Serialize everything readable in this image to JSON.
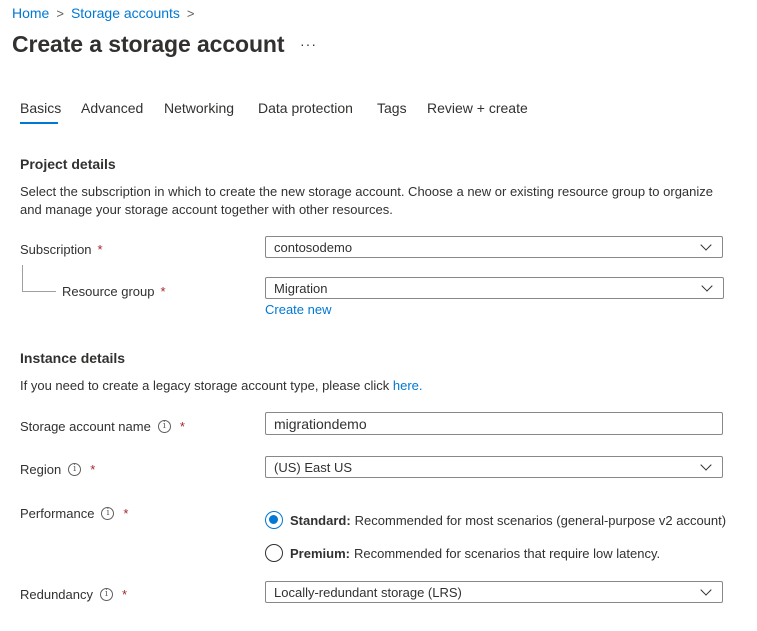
{
  "breadcrumb": {
    "home": "Home",
    "storage_accounts": "Storage accounts",
    "sep1": ">",
    "sep2": ">"
  },
  "page": {
    "title": "Create a storage account",
    "more": "···"
  },
  "tabs": [
    {
      "label": "Basics",
      "active": true
    },
    {
      "label": "Advanced"
    },
    {
      "label": "Networking"
    },
    {
      "label": "Data protection"
    },
    {
      "label": "Tags"
    },
    {
      "label": "Review + create"
    }
  ],
  "project": {
    "title": "Project details",
    "description": "Select the subscription in which to create the new storage account. Choose a new or existing resource group to organize and manage your storage account together with other resources.",
    "subscription_label": "Subscription",
    "subscription_value": "contosodemo",
    "resource_group_label": "Resource group",
    "resource_group_value": "Migration",
    "create_new": "Create new"
  },
  "instance": {
    "title": "Instance details",
    "description_prefix": "If you need to create a legacy storage account type, please click ",
    "description_link": "here.",
    "name_label": "Storage account name",
    "name_value": "migrationdemo",
    "region_label": "Region",
    "region_value": "(US) East US",
    "performance_label": "Performance",
    "performance_options": [
      {
        "name": "Standard:",
        "desc": "Recommended for most scenarios (general-purpose v2 account)",
        "selected": true
      },
      {
        "name": "Premium:",
        "desc": "Recommended for scenarios that require low latency.",
        "selected": false
      }
    ],
    "redundancy_label": "Redundancy",
    "redundancy_value": "Locally-redundant storage (LRS)"
  },
  "required_marker": "*",
  "info_glyph": "i",
  "colors": {
    "accent": "#0078d4",
    "required": "#a4262c",
    "text": "#323130"
  }
}
